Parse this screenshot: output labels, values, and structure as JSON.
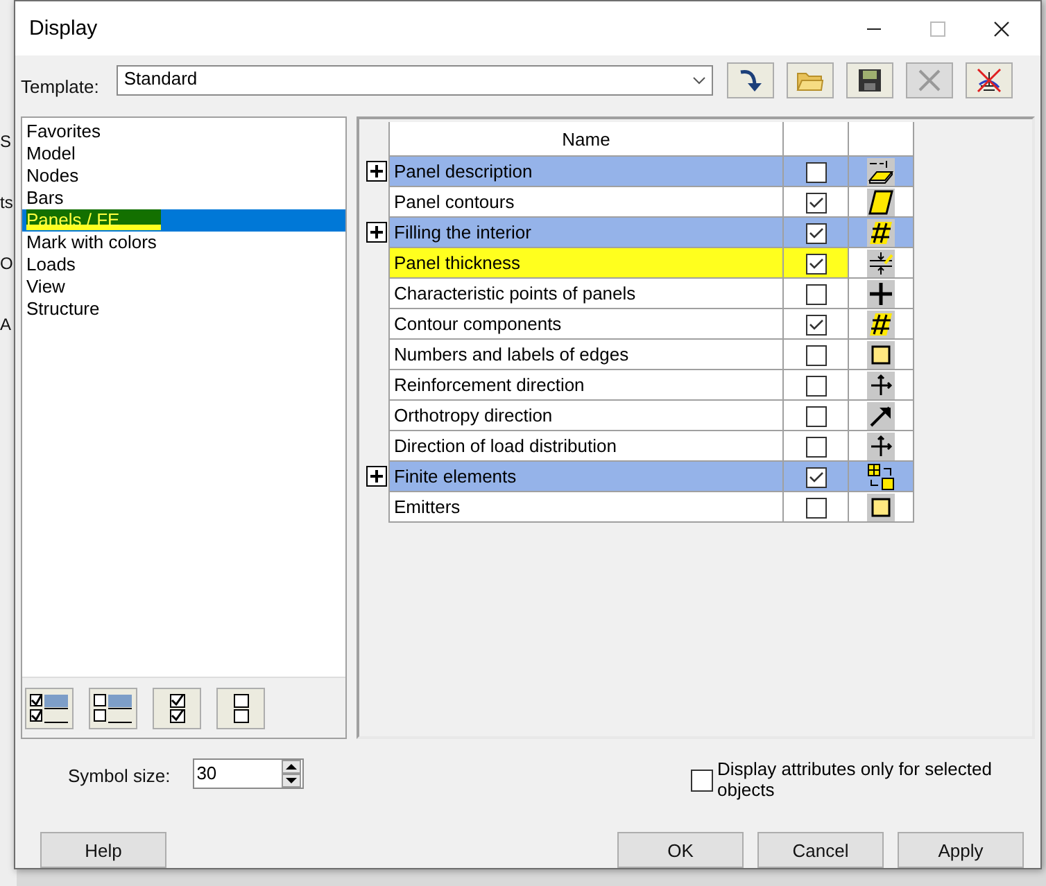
{
  "background_fragments": [
    "S",
    "ts",
    "O",
    "A"
  ],
  "window": {
    "title": "Display"
  },
  "template": {
    "label": "Template:",
    "value": "Standard"
  },
  "toolbar": [
    {
      "kind": "insert",
      "disabled": false
    },
    {
      "kind": "open",
      "disabled": false
    },
    {
      "kind": "save",
      "disabled": false
    },
    {
      "kind": "delete",
      "disabled": true
    },
    {
      "kind": "clear",
      "disabled": false
    }
  ],
  "categories": [
    {
      "label": "Favorites",
      "selected": false,
      "highlighted": false
    },
    {
      "label": "Model",
      "selected": false,
      "highlighted": false
    },
    {
      "label": "Nodes",
      "selected": false,
      "highlighted": false
    },
    {
      "label": "Bars",
      "selected": false,
      "highlighted": false
    },
    {
      "label": "Panels / FE",
      "selected": true,
      "highlighted": true
    },
    {
      "label": "Mark with colors",
      "selected": false,
      "highlighted": false
    },
    {
      "label": "Loads",
      "selected": false,
      "highlighted": false
    },
    {
      "label": "View",
      "selected": false,
      "highlighted": false
    },
    {
      "label": "Structure",
      "selected": false,
      "highlighted": false
    }
  ],
  "list_buttons": [
    {
      "kind": "check-all-rows"
    },
    {
      "kind": "uncheck-all-rows"
    },
    {
      "kind": "check-all"
    },
    {
      "kind": "uncheck-all"
    }
  ],
  "table": {
    "columns": [
      "Name"
    ],
    "rows": [
      {
        "name": "Panel description",
        "expandable": true,
        "group": true,
        "checked": false,
        "highlighted": false,
        "kind": "label"
      },
      {
        "name": "Panel contours",
        "expandable": false,
        "group": false,
        "checked": true,
        "highlighted": false,
        "kind": "panel"
      },
      {
        "name": "Filling the interior",
        "expandable": true,
        "group": true,
        "checked": true,
        "highlighted": false,
        "kind": "hatch"
      },
      {
        "name": "Panel thickness",
        "expandable": false,
        "group": false,
        "checked": true,
        "highlighted": true,
        "kind": "thickness"
      },
      {
        "name": "Characteristic points of panels",
        "expandable": false,
        "group": false,
        "checked": false,
        "highlighted": false,
        "kind": "cross"
      },
      {
        "name": "Contour components",
        "expandable": false,
        "group": false,
        "checked": true,
        "highlighted": false,
        "kind": "hatch"
      },
      {
        "name": "Numbers and labels of edges",
        "expandable": false,
        "group": false,
        "checked": false,
        "highlighted": false,
        "kind": "square"
      },
      {
        "name": "Reinforcement direction",
        "expandable": false,
        "group": false,
        "checked": false,
        "highlighted": false,
        "kind": "axes"
      },
      {
        "name": "Orthotropy direction",
        "expandable": false,
        "group": false,
        "checked": false,
        "highlighted": false,
        "kind": "arrow"
      },
      {
        "name": "Direction of load distribution",
        "expandable": false,
        "group": false,
        "checked": false,
        "highlighted": false,
        "kind": "axes"
      },
      {
        "name": "Finite elements",
        "expandable": true,
        "group": true,
        "checked": true,
        "highlighted": false,
        "kind": "mesh"
      },
      {
        "name": "Emitters",
        "expandable": false,
        "group": false,
        "checked": false,
        "highlighted": false,
        "kind": "square"
      }
    ]
  },
  "symbol_size": {
    "label": "Symbol size:",
    "value": "30"
  },
  "selected_only": {
    "label": "Display attributes only for selected objects",
    "checked": false
  },
  "buttons": [
    {
      "label": "Help",
      "kind": "help"
    },
    {
      "label": "OK",
      "kind": "ok"
    },
    {
      "label": "Cancel",
      "kind": "cancel"
    },
    {
      "label": "Apply",
      "kind": "apply"
    }
  ]
}
